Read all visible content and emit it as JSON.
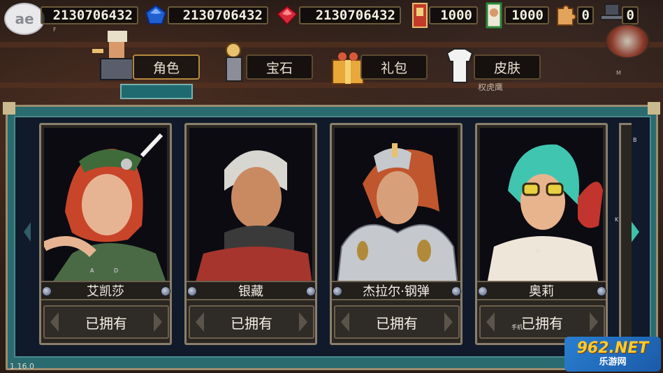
{
  "currencies": [
    {
      "name": "silver-coin",
      "value": "2130706432"
    },
    {
      "name": "blue-gem",
      "value": "2130706432"
    },
    {
      "name": "red-gem",
      "value": "2130706432"
    },
    {
      "name": "red-ticket",
      "value": "1000"
    },
    {
      "name": "card-ticket",
      "value": "1000"
    },
    {
      "name": "puzzle-piece",
      "value": "0"
    },
    {
      "name": "hat-token",
      "value": "0"
    }
  ],
  "tabs": [
    {
      "label": "角色",
      "active": true
    },
    {
      "label": "宝石",
      "active": false
    },
    {
      "label": "礼包",
      "active": false
    },
    {
      "label": "皮肤",
      "active": false
    }
  ],
  "background_text": {
    "frag1": "F",
    "frag2": "权虎鹰",
    "frag3": "M",
    "frag4": "B",
    "frag5": "K"
  },
  "cards": [
    {
      "name": "艾凯莎",
      "status": "已拥有",
      "hair": "#c8452a",
      "skin": "#e7b493",
      "outfit": "#3f6b3a",
      "accent": "#4a6a46"
    },
    {
      "name": "银藏",
      "status": "已拥有",
      "hair": "#d8d6d0",
      "skin": "#c98a62",
      "outfit": "#a6352e",
      "accent": "#3a3a3a"
    },
    {
      "name": "杰拉尔·钢弹",
      "status": "已拥有",
      "hair": "#c0562e",
      "skin": "#d8a07a",
      "outfit": "#c5c8cc",
      "accent": "#b08a3a"
    },
    {
      "name": "奥莉",
      "status": "已拥有",
      "hair": "#3fc5b0",
      "skin": "#e8b48e",
      "outfit": "#efe6da",
      "accent": "#c2352e"
    }
  ],
  "card_overlay_texts": {
    "c1_a": "A",
    "c1_d": "D",
    "c4_h": "H",
    "c4_tag": "手机"
  },
  "version": "1.16.0",
  "watermark": {
    "top": "962.NET",
    "bottom": "乐游网"
  },
  "colors": {
    "panel": "#2a6b70",
    "panel_inner": "#101a2a",
    "card_border": "#8a7f6a",
    "accent_green": "#3ec0a8"
  }
}
